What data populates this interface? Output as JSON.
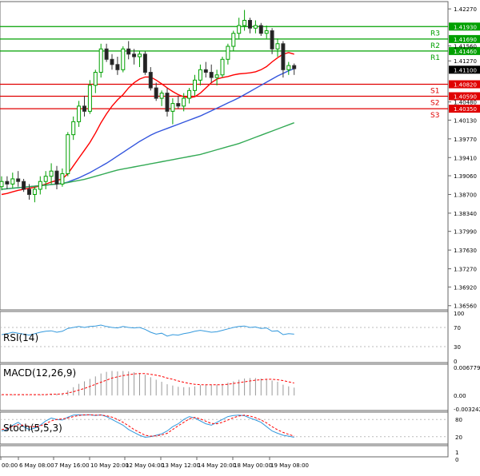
{
  "chart_data": {
    "type": "candlestick",
    "instrument_hint": "GBP/USD (values as shown)",
    "x_labels": [
      "00:00",
      "6 May 08:00",
      "7 May 16:00",
      "10 May 20:00",
      "12 May 04:00",
      "13 May 12:00",
      "14 May 20:00",
      "18 May 00:00",
      "19 May 08:00"
    ],
    "y_ticks": [
      1.4227,
      1.4156,
      1.4127,
      1.4048,
      1.4013,
      1.3977,
      1.3941,
      1.3906,
      1.387,
      1.3834,
      1.3799,
      1.3763,
      1.3727,
      1.3692,
      1.3656
    ],
    "ylim": [
      1.3651,
      1.4238
    ],
    "candles": [
      {
        "o": 1.3885,
        "h": 1.3905,
        "l": 1.3878,
        "c": 1.3895
      },
      {
        "o": 1.3895,
        "h": 1.3905,
        "l": 1.388,
        "c": 1.389
      },
      {
        "o": 1.389,
        "h": 1.3912,
        "l": 1.3882,
        "c": 1.39
      },
      {
        "o": 1.39,
        "h": 1.3915,
        "l": 1.3885,
        "c": 1.3895
      },
      {
        "o": 1.3895,
        "h": 1.39,
        "l": 1.3875,
        "c": 1.388
      },
      {
        "o": 1.388,
        "h": 1.389,
        "l": 1.386,
        "c": 1.387
      },
      {
        "o": 1.387,
        "h": 1.3885,
        "l": 1.3855,
        "c": 1.388
      },
      {
        "o": 1.388,
        "h": 1.3905,
        "l": 1.387,
        "c": 1.3895
      },
      {
        "o": 1.3895,
        "h": 1.3915,
        "l": 1.388,
        "c": 1.3905
      },
      {
        "o": 1.3905,
        "h": 1.393,
        "l": 1.389,
        "c": 1.3915
      },
      {
        "o": 1.3915,
        "h": 1.3925,
        "l": 1.388,
        "c": 1.389
      },
      {
        "o": 1.389,
        "h": 1.392,
        "l": 1.3885,
        "c": 1.391
      },
      {
        "o": 1.391,
        "h": 1.399,
        "l": 1.3905,
        "c": 1.3985
      },
      {
        "o": 1.3985,
        "h": 1.402,
        "l": 1.3975,
        "c": 1.401
      },
      {
        "o": 1.401,
        "h": 1.405,
        "l": 1.4,
        "c": 1.404
      },
      {
        "o": 1.404,
        "h": 1.406,
        "l": 1.402,
        "c": 1.403
      },
      {
        "o": 1.403,
        "h": 1.409,
        "l": 1.4025,
        "c": 1.408
      },
      {
        "o": 1.408,
        "h": 1.411,
        "l": 1.4065,
        "c": 1.4105
      },
      {
        "o": 1.4105,
        "h": 1.416,
        "l": 1.4095,
        "c": 1.415
      },
      {
        "o": 1.415,
        "h": 1.416,
        "l": 1.4125,
        "c": 1.413
      },
      {
        "o": 1.413,
        "h": 1.414,
        "l": 1.411,
        "c": 1.412
      },
      {
        "o": 1.412,
        "h": 1.4135,
        "l": 1.41,
        "c": 1.411
      },
      {
        "o": 1.411,
        "h": 1.4155,
        "l": 1.4105,
        "c": 1.415
      },
      {
        "o": 1.415,
        "h": 1.4165,
        "l": 1.413,
        "c": 1.414
      },
      {
        "o": 1.414,
        "h": 1.415,
        "l": 1.412,
        "c": 1.4135
      },
      {
        "o": 1.4135,
        "h": 1.4145,
        "l": 1.4115,
        "c": 1.414
      },
      {
        "o": 1.414,
        "h": 1.4145,
        "l": 1.41,
        "c": 1.4105
      },
      {
        "o": 1.4105,
        "h": 1.4115,
        "l": 1.407,
        "c": 1.4075
      },
      {
        "o": 1.4075,
        "h": 1.4085,
        "l": 1.405,
        "c": 1.4055
      },
      {
        "o": 1.4055,
        "h": 1.407,
        "l": 1.404,
        "c": 1.4065
      },
      {
        "o": 1.4065,
        "h": 1.4075,
        "l": 1.402,
        "c": 1.403
      },
      {
        "o": 1.403,
        "h": 1.4055,
        "l": 1.4005,
        "c": 1.4045
      },
      {
        "o": 1.4045,
        "h": 1.406,
        "l": 1.4035,
        "c": 1.404
      },
      {
        "o": 1.404,
        "h": 1.4065,
        "l": 1.403,
        "c": 1.4055
      },
      {
        "o": 1.4055,
        "h": 1.4075,
        "l": 1.4045,
        "c": 1.407
      },
      {
        "o": 1.407,
        "h": 1.41,
        "l": 1.406,
        "c": 1.409
      },
      {
        "o": 1.409,
        "h": 1.412,
        "l": 1.408,
        "c": 1.411
      },
      {
        "o": 1.411,
        "h": 1.4125,
        "l": 1.4095,
        "c": 1.4105
      },
      {
        "o": 1.4105,
        "h": 1.412,
        "l": 1.4085,
        "c": 1.4095
      },
      {
        "o": 1.4095,
        "h": 1.411,
        "l": 1.408,
        "c": 1.41
      },
      {
        "o": 1.41,
        "h": 1.4135,
        "l": 1.4095,
        "c": 1.413
      },
      {
        "o": 1.413,
        "h": 1.416,
        "l": 1.412,
        "c": 1.4155
      },
      {
        "o": 1.4155,
        "h": 1.4185,
        "l": 1.4145,
        "c": 1.418
      },
      {
        "o": 1.418,
        "h": 1.421,
        "l": 1.417,
        "c": 1.4195
      },
      {
        "o": 1.4195,
        "h": 1.4225,
        "l": 1.4185,
        "c": 1.4205
      },
      {
        "o": 1.4205,
        "h": 1.421,
        "l": 1.418,
        "c": 1.419
      },
      {
        "o": 1.419,
        "h": 1.4205,
        "l": 1.418,
        "c": 1.4195
      },
      {
        "o": 1.4195,
        "h": 1.42,
        "l": 1.4175,
        "c": 1.418
      },
      {
        "o": 1.418,
        "h": 1.4195,
        "l": 1.417,
        "c": 1.4185
      },
      {
        "o": 1.4185,
        "h": 1.419,
        "l": 1.414,
        "c": 1.415
      },
      {
        "o": 1.415,
        "h": 1.417,
        "l": 1.4135,
        "c": 1.416
      },
      {
        "o": 1.416,
        "h": 1.4165,
        "l": 1.4095,
        "c": 1.411
      },
      {
        "o": 1.411,
        "h": 1.4125,
        "l": 1.41,
        "c": 1.4118
      },
      {
        "o": 1.4118,
        "h": 1.4122,
        "l": 1.41,
        "c": 1.4112
      }
    ],
    "series": [
      {
        "name": "",
        "color": "#ff0000",
        "values": [
          1.387,
          1.3872,
          1.3875,
          1.3878,
          1.388,
          1.3882,
          1.3884,
          1.3887,
          1.389,
          1.3894,
          1.3897,
          1.39,
          1.391,
          1.3925,
          1.394,
          1.3955,
          1.397,
          1.3988,
          1.4008,
          1.4025,
          1.404,
          1.4052,
          1.4062,
          1.4075,
          1.4085,
          1.4092,
          1.4096,
          1.4096,
          1.409,
          1.4083,
          1.4075,
          1.4068,
          1.4062,
          1.4058,
          1.4056,
          1.4058,
          1.4065,
          1.4075,
          1.4085,
          1.4092,
          1.4095,
          1.4097,
          1.41,
          1.4102,
          1.4103,
          1.4104,
          1.4106,
          1.411,
          1.4116,
          1.4125,
          1.4133,
          1.414,
          1.4143,
          1.414
        ]
      },
      {
        "name": "",
        "color": "#3355dd",
        "values": [
          1.388,
          1.3881,
          1.3882,
          1.3883,
          1.3884,
          1.3885,
          1.3886,
          1.3887,
          1.3888,
          1.3889,
          1.389,
          1.3891,
          1.3894,
          1.3898,
          1.3902,
          1.3907,
          1.3912,
          1.3918,
          1.3924,
          1.393,
          1.3937,
          1.3944,
          1.3951,
          1.3958,
          1.3965,
          1.3972,
          1.3978,
          1.3984,
          1.3989,
          1.3993,
          1.3997,
          1.4001,
          1.4005,
          1.4009,
          1.4013,
          1.4017,
          1.4021,
          1.4026,
          1.4031,
          1.4036,
          1.4041,
          1.4046,
          1.4051,
          1.4056,
          1.4062,
          1.4068,
          1.4074,
          1.408,
          1.4086,
          1.4092,
          1.4098,
          1.4103,
          1.4108,
          1.4112
        ]
      },
      {
        "name": "",
        "color": "#33aa55",
        "values": [
          1.388,
          1.3881,
          1.3882,
          1.3883,
          1.3884,
          1.3885,
          1.3886,
          1.3887,
          1.3888,
          1.3889,
          1.389,
          1.3891,
          1.3893,
          1.3895,
          1.3897,
          1.3899,
          1.3902,
          1.3905,
          1.3908,
          1.3911,
          1.3914,
          1.3917,
          1.3919,
          1.3921,
          1.3923,
          1.3925,
          1.3927,
          1.3929,
          1.3931,
          1.3933,
          1.3935,
          1.3937,
          1.3939,
          1.3941,
          1.3943,
          1.3945,
          1.3947,
          1.395,
          1.3953,
          1.3956,
          1.3959,
          1.3962,
          1.3965,
          1.3968,
          1.3972,
          1.3976,
          1.398,
          1.3984,
          1.3988,
          1.3992,
          1.3996,
          1.4,
          1.4004,
          1.4008
        ]
      }
    ],
    "levels": [
      {
        "label": "R3",
        "price_label": "1.41930",
        "value": 1.4193,
        "color": "#00a000"
      },
      {
        "label": "R2",
        "price_label": "1.41690",
        "value": 1.4169,
        "color": "#00a000"
      },
      {
        "label": "R1",
        "price_label": "1.41460",
        "value": 1.4146,
        "color": "#00a000"
      },
      {
        "label": "S1",
        "price_label": "1.40820",
        "value": 1.4082,
        "color": "#e00000"
      },
      {
        "label": "S2",
        "price_label": "1.40590",
        "value": 1.4059,
        "color": "#e00000"
      },
      {
        "label": "S3",
        "price_label": "1.40350",
        "value": 1.4035,
        "color": "#e00000"
      }
    ],
    "current_price": {
      "label": "1.41100",
      "value": 1.411
    },
    "indicators": {
      "rsi": {
        "title": "RSI(14)",
        "ticks": [
          100,
          70,
          30,
          0
        ],
        "ylim": [
          0,
          100
        ],
        "color": "#3399dd",
        "values": [
          55,
          57,
          60,
          58,
          56,
          54,
          57,
          60,
          62,
          63,
          60,
          62,
          68,
          70,
          72,
          70,
          72,
          73,
          75,
          72,
          70,
          69,
          72,
          70,
          69,
          70,
          66,
          60,
          56,
          58,
          52,
          55,
          54,
          57,
          59,
          62,
          64,
          62,
          60,
          61,
          64,
          67,
          70,
          72,
          73,
          70,
          71,
          68,
          69,
          62,
          63,
          55,
          57,
          56
        ]
      },
      "macd": {
        "title": "MACD(12,26,9)",
        "ticks": [
          "0.006779",
          "0.00",
          "-0.003242"
        ],
        "ylim": [
          -0.003242,
          0.006779
        ],
        "histogram_color": "#999999",
        "signal_color": "#ff0000",
        "histogram": [
          0.0001,
          0.0001,
          0.0002,
          0.0002,
          0.0002,
          0.0001,
          0.0001,
          0.0002,
          0.0003,
          0.0004,
          0.0004,
          0.0005,
          0.0012,
          0.002,
          0.0028,
          0.0034,
          0.004,
          0.0046,
          0.0053,
          0.0057,
          0.0059,
          0.0058,
          0.0059,
          0.0058,
          0.0056,
          0.0054,
          0.005,
          0.0044,
          0.0038,
          0.0033,
          0.0027,
          0.0024,
          0.0021,
          0.002,
          0.002,
          0.0022,
          0.0025,
          0.0026,
          0.0026,
          0.0026,
          0.0028,
          0.0031,
          0.0034,
          0.0038,
          0.0041,
          0.0042,
          0.0042,
          0.0041,
          0.004,
          0.0036,
          0.0033,
          0.0026,
          0.0022,
          0.0019
        ],
        "signal": [
          0.0002,
          0.0002,
          0.0002,
          0.0002,
          0.0002,
          0.0002,
          0.0002,
          0.0002,
          0.0002,
          0.0003,
          0.0003,
          0.0004,
          0.0006,
          0.0009,
          0.0013,
          0.0017,
          0.0022,
          0.0027,
          0.0032,
          0.0037,
          0.0042,
          0.0045,
          0.0048,
          0.005,
          0.0052,
          0.0053,
          0.0053,
          0.0051,
          0.0049,
          0.0046,
          0.0042,
          0.0039,
          0.0035,
          0.0032,
          0.0029,
          0.0027,
          0.0026,
          0.0026,
          0.0026,
          0.0026,
          0.0026,
          0.0027,
          0.0029,
          0.0031,
          0.0033,
          0.0035,
          0.0037,
          0.0038,
          0.0039,
          0.0039,
          0.0038,
          0.0036,
          0.0033,
          0.003
        ]
      },
      "stoch": {
        "title": "Stoch(5,5,3)",
        "ticks": [
          "80",
          "20",
          "1",
          "0"
        ],
        "ylim": [
          0,
          100
        ],
        "main_color": "#3399dd",
        "signal_color": "#ff0000",
        "main": [
          40,
          45,
          60,
          70,
          55,
          45,
          50,
          60,
          75,
          85,
          80,
          78,
          88,
          95,
          96,
          95,
          96,
          94,
          96,
          90,
          80,
          70,
          60,
          45,
          35,
          25,
          18,
          20,
          25,
          30,
          40,
          55,
          65,
          80,
          90,
          85,
          75,
          65,
          60,
          70,
          80,
          90,
          94,
          95,
          93,
          85,
          78,
          70,
          55,
          40,
          32,
          25,
          22,
          18
        ],
        "signal": [
          45,
          48,
          55,
          62,
          60,
          55,
          55,
          58,
          65,
          75,
          80,
          82,
          85,
          90,
          94,
          96,
          96,
          95,
          95,
          93,
          88,
          80,
          70,
          58,
          45,
          35,
          25,
          22,
          23,
          26,
          32,
          45,
          58,
          70,
          82,
          87,
          82,
          74,
          66,
          65,
          70,
          78,
          86,
          92,
          95,
          92,
          86,
          78,
          68,
          55,
          44,
          35,
          28,
          22
        ]
      }
    },
    "colors": {
      "grid_separator": "#888888",
      "bull_candle": "#00a000",
      "bear_candle": "#333333"
    }
  }
}
